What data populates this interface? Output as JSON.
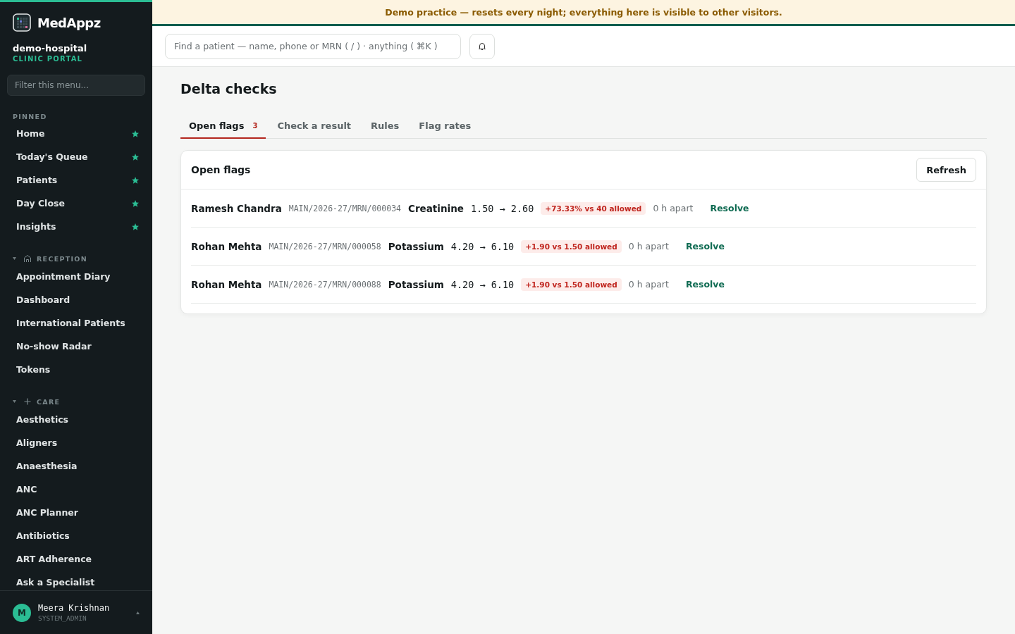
{
  "brand": {
    "name": "MedAppz",
    "org": "demo-hospital",
    "portal": "CLINIC PORTAL"
  },
  "sidebar": {
    "filter_placeholder": "Filter this menu...",
    "pinned_label": "PINNED",
    "pinned": [
      {
        "label": "Home",
        "pinned": true
      },
      {
        "label": "Today's Queue",
        "pinned": true
      },
      {
        "label": "Patients",
        "pinned": true
      },
      {
        "label": "Day Close",
        "pinned": true
      },
      {
        "label": "Insights",
        "pinned": true
      }
    ],
    "groups": [
      {
        "label": "RECEPTION",
        "kind": "house",
        "expanded": true,
        "items": [
          "Appointment Diary",
          "Dashboard",
          "International Patients",
          "No-show Radar",
          "Tokens"
        ]
      },
      {
        "label": "CARE",
        "kind": "plus",
        "expanded": true,
        "items": [
          "Aesthetics",
          "Aligners",
          "Anaesthesia",
          "ANC",
          "ANC Planner",
          "Antibiotics",
          "ART Adherence",
          "Ask a Specialist"
        ]
      }
    ],
    "user": {
      "initial": "M",
      "name": "Meera Krishnan",
      "role": "SYSTEM_ADMIN"
    }
  },
  "banner": "Demo practice — resets every night; everything here is visible to other visitors.",
  "search": {
    "placeholder": "Find a patient — name, phone or MRN ( / ) · anything ( ⌘K )"
  },
  "page": {
    "title": "Delta checks",
    "tabs": [
      {
        "label": "Open flags",
        "count": "3",
        "selected": true
      },
      {
        "label": "Check a result",
        "selected": false
      },
      {
        "label": "Rules",
        "selected": false
      },
      {
        "label": "Flag rates",
        "selected": false
      }
    ],
    "card": {
      "title": "Open flags",
      "refresh": "Refresh",
      "rows": [
        {
          "patient": "Ramesh Chandra",
          "mrn": "MAIN/2026-27/MRN/000034",
          "test": "Creatinine",
          "values": "1.50 → 2.60",
          "delta": "+73.33% vs 40 allowed",
          "gap": "0 h apart",
          "action": "Resolve"
        },
        {
          "patient": "Rohan Mehta",
          "mrn": "MAIN/2026-27/MRN/000058",
          "test": "Potassium",
          "values": "4.20 → 6.10",
          "delta": "+1.90 vs 1.50 allowed",
          "gap": "0 h apart",
          "action": "Resolve"
        },
        {
          "patient": "Rohan Mehta",
          "mrn": "MAIN/2026-27/MRN/000088",
          "test": "Potassium",
          "values": "4.20 → 6.10",
          "delta": "+1.90 vs 1.50 allowed",
          "gap": "0 h apart",
          "action": "Resolve"
        }
      ]
    }
  }
}
